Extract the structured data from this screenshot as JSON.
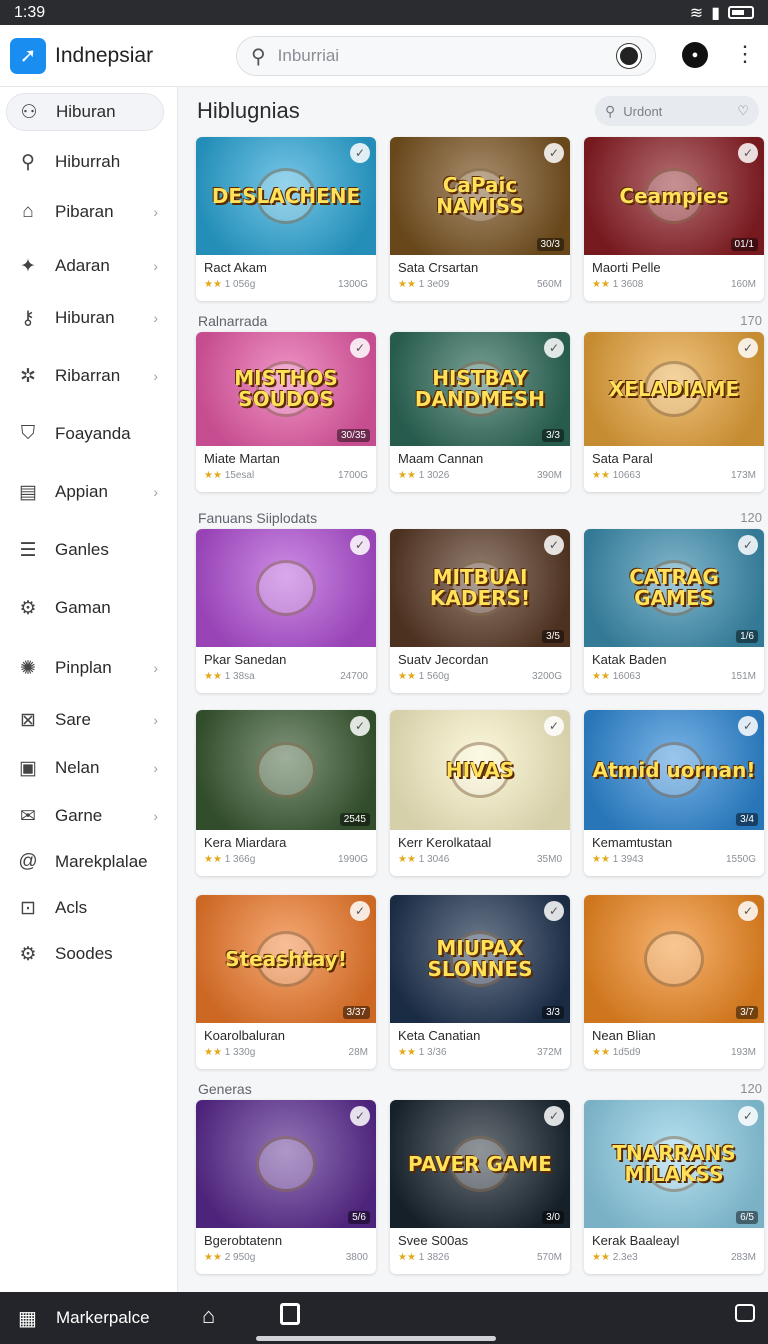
{
  "status": {
    "time": "1:39"
  },
  "app": {
    "name": "Indnepsiar"
  },
  "search": {
    "placeholder": "Inburriai"
  },
  "sidebar": {
    "items": [
      {
        "label": "Hiburan",
        "icon": "person-icon",
        "chevron": false,
        "active": true
      },
      {
        "label": "Hiburrah",
        "icon": "search-icon",
        "chevron": false,
        "active": false
      },
      {
        "label": "Pibaran",
        "icon": "home-icon",
        "chevron": true,
        "active": false
      },
      {
        "label": "Adaran",
        "icon": "compass-icon",
        "chevron": true,
        "active": false
      },
      {
        "label": "Hiburan",
        "icon": "key-icon",
        "chevron": true,
        "active": false
      },
      {
        "label": "Ribarran",
        "icon": "star-icon",
        "chevron": true,
        "active": false
      },
      {
        "label": "Foayanda",
        "icon": "shield-icon",
        "chevron": false,
        "active": false
      },
      {
        "label": "Appian",
        "icon": "calendar-icon",
        "chevron": true,
        "active": false
      },
      {
        "label": "Ganles",
        "icon": "document-icon",
        "chevron": false,
        "active": false
      },
      {
        "label": "Gaman",
        "icon": "gear-icon",
        "chevron": false,
        "active": false
      },
      {
        "label": "Pinplan",
        "icon": "cog-icon",
        "chevron": true,
        "active": false
      },
      {
        "label": "Sare",
        "icon": "bookmark-icon",
        "chevron": true,
        "active": false
      },
      {
        "label": "Nelan",
        "icon": "bag-icon",
        "chevron": true,
        "active": false
      },
      {
        "label": "Garne",
        "icon": "mail-icon",
        "chevron": true,
        "active": false
      },
      {
        "label": "Marekplalae",
        "icon": "at-icon",
        "chevron": false,
        "active": false
      },
      {
        "label": "Acls",
        "icon": "inbox-icon",
        "chevron": false,
        "active": false
      },
      {
        "label": "Soodes",
        "icon": "gear-icon",
        "chevron": false,
        "active": false
      }
    ]
  },
  "main": {
    "title": "Hiblugnias",
    "mini_search_placeholder": "Urdont",
    "sections": [
      {
        "label": "",
        "count": ""
      },
      {
        "label": "Ralnarrada",
        "count": "170"
      },
      {
        "label": "Fanuans Siiplodats",
        "count": "120"
      },
      {
        "label": "",
        "count": ""
      },
      {
        "label": "",
        "count": ""
      },
      {
        "label": "Generas",
        "count": "120"
      }
    ],
    "cards": [
      [
        {
          "thumb_text": "DESLACHENE",
          "name": "Ract Akam",
          "meta": "1 056g",
          "size": "1300G",
          "tag": "",
          "bg": "#2aa7d8"
        },
        {
          "thumb_text": "CaPaic NAMISS",
          "name": "Sata Crsartan",
          "meta": "1 3e09",
          "size": "560M",
          "tag": "30/3",
          "bg": "#7a5320"
        },
        {
          "thumb_text": "Ceampies",
          "name": "Maorti Pelle",
          "meta": "1 3608",
          "size": "160M",
          "tag": "01/1",
          "bg": "#8b1e24"
        }
      ],
      [
        {
          "thumb_text": "MISTHOS SOUDOS",
          "name": "Miate Martan",
          "meta": "15esal",
          "size": "1700G",
          "tag": "30/35",
          "bg": "#e85aa8"
        },
        {
          "thumb_text": "HISTBAY DANDMESH",
          "name": "Maam Cannan",
          "meta": "1 3026",
          "size": "390M",
          "tag": "3/3",
          "bg": "#2e6b5a"
        },
        {
          "thumb_text": "XELADIAME",
          "name": "Sata Paral",
          "meta": "10663",
          "size": "173M",
          "tag": "",
          "bg": "#e8a43a"
        }
      ],
      [
        {
          "thumb_text": "",
          "name": "Pkar Sanedan",
          "meta": "1 38sa",
          "size": "24700",
          "tag": "",
          "bg": "#b24fd6"
        },
        {
          "thumb_text": "MITBUAI KADERS!",
          "name": "Suatv Jecordan",
          "meta": "1 560g",
          "size": "3200G",
          "tag": "3/5",
          "bg": "#5a3a26"
        },
        {
          "thumb_text": "CATRAG GAMES",
          "name": "Katak Baden",
          "meta": "16063",
          "size": "151M",
          "tag": "1/6",
          "bg": "#3d8fb0"
        }
      ],
      [
        {
          "thumb_text": "",
          "name": "Kera Miardara",
          "meta": "1 366g",
          "size": "1990G",
          "tag": "2545",
          "bg": "#3a5a32"
        },
        {
          "thumb_text": "HIVAS",
          "name": "Kerr Kerolkataal",
          "meta": "1 3046",
          "size": "35M0",
          "tag": "",
          "bg": "#fbf4c8"
        },
        {
          "thumb_text": "Atmid uornan!",
          "name": "Kemamtustan",
          "meta": "1 3943",
          "size": "1550G",
          "tag": "3/4",
          "bg": "#2f8ad8"
        }
      ],
      [
        {
          "thumb_text": "Steashtay!",
          "name": "Koarolbaluran",
          "meta": "1 330g",
          "size": "28M",
          "tag": "3/37",
          "bg": "#f07a2a"
        },
        {
          "thumb_text": "MIUPAX SLONNES",
          "name": "Keta Canatian",
          "meta": "1 3/36",
          "size": "372M",
          "tag": "3/3",
          "bg": "#1f3350"
        },
        {
          "thumb_text": "",
          "name": "Nean Blian",
          "meta": "1d5d9",
          "size": "193M",
          "tag": "3/7",
          "bg": "#f28a22"
        }
      ],
      [
        {
          "thumb_text": "",
          "name": "Bgerobtatenn",
          "meta": "2 950g",
          "size": "3800",
          "tag": "5/6",
          "bg": "#5a2a90"
        },
        {
          "thumb_text": "PAVER GAME",
          "name": "Svee S00as",
          "meta": "1 3826",
          "size": "570M",
          "tag": "3/0",
          "bg": "#1a2630"
        },
        {
          "thumb_text": "TNARRANS MILAKSS",
          "name": "Kerak Baaleayl",
          "meta": "2.3e3",
          "size": "283M",
          "tag": "6/5",
          "bg": "#8fd0e8"
        }
      ]
    ]
  },
  "bottom": {
    "label": "Markerpalce"
  }
}
